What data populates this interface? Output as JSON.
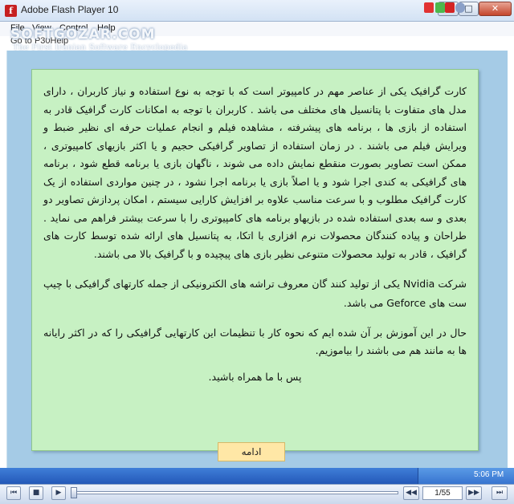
{
  "window": {
    "title": "Adobe Flash Player 10",
    "app_icon": "f",
    "minimize_glyph": "–",
    "maximize_glyph": "□",
    "close_glyph": "✕"
  },
  "menu": {
    "items": [
      "File",
      "View",
      "Control",
      "Help"
    ]
  },
  "subline": "Go to P30Help",
  "watermark": {
    "logo": "SOFTGOZAR.COM",
    "tagline": "The First Iranian Software Encyclopedia"
  },
  "content": {
    "paragraph_1": "کارت گرافیک یکی از عناصر مهم در کامپیوتر است که با توجه به نوع استفاده و نیاز کاربران ، دارای مدل های متفاوت با پتانسیل های مختلف می باشد . کاربران با توجه به امکانات کارت گرافیک قادر به استفاده از بازی ها ، برنامه های پیشرفته ، مشاهده فیلم و انجام عملیات حرفه ای نظیر ضبط و ویرایش فیلم می باشند . در زمان استفاده از تصاویر گرافیکی حجیم و یا اکثر بازیهای کامپیوتری ، ممکن است تصاویر بصورت منقطع نمایش داده می شوند ، ناگهان بازی یا برنامه قطع شود ، برنامه های گرافیکی به کندی اجرا شود و یا اصلاً بازی یا برنامه اجرا نشود ، در چنین مواردی استفاده از یک کارت گرافیک مطلوب و با سرعت مناسب علاوه بر افزایش کارایی سیستم ، امکان پردازش تصاویر دو بعدی و سه بعدی استفاده شده در بازیهاو برنامه های کامپیوتری را با سرعت بیشتر فراهم می نماید . طراحان و پیاده کنندگان محصولات نرم افزاری با اتکا، به پتانسیل های ارائه شده توسط کارت های گرافیک ، قادر به تولید محصولات متنوعی نظیر بازی های پیچیده و با گرافیک بالا می باشند.",
    "paragraph_2": "شرکت Nvidia یکی از تولید کنند گان معروف تراشه های الکترونیکی از جمله کارتهای گرافیکی با چیپ ست های Geforce می باشد.",
    "paragraph_3": "حال در این آموزش بر آن شده ایم که نحوه کار با تنظیمات این کارتهایی گرافیکی را که در اکثر رایانه ها به مانند هم می باشند را بیاموزیم.",
    "paragraph_4": "پس با ما همراه باشید.",
    "continue_button": "ادامه"
  },
  "tray": {
    "time": "5:06 PM",
    "icons": [
      "alert-icon",
      "network-icon",
      "antivirus-icon",
      "help-icon"
    ]
  },
  "player": {
    "page_indicator": "1/55",
    "progress_fraction": 0.0,
    "first_glyph": "⏮",
    "stop_glyph": "■",
    "play_glyph": "▶",
    "prev_glyph": "◀◀",
    "next_glyph": "▶▶",
    "last_glyph": "⏭"
  },
  "colors": {
    "stage": "#a5cbe6",
    "content_box": "#c7f1c3",
    "continue_button": "#ffe7a6",
    "taskbar": "#2f6bcb"
  }
}
